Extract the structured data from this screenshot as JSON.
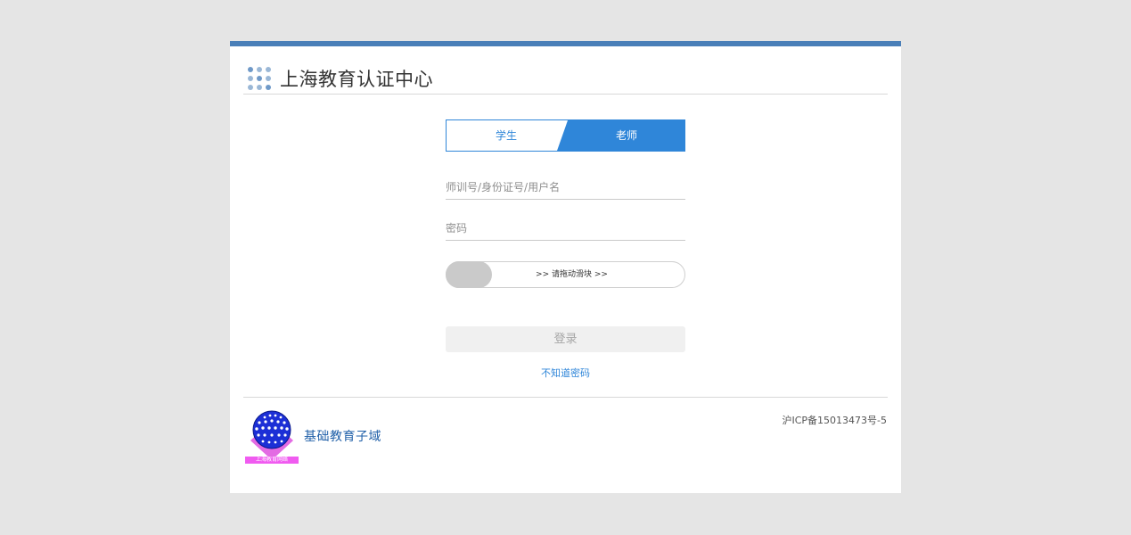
{
  "header": {
    "title": "上海教育认证中心"
  },
  "tabs": [
    {
      "label": "学生",
      "active": false
    },
    {
      "label": "老师",
      "active": true
    }
  ],
  "form": {
    "username_placeholder": "师训号/身份证号/用户名",
    "password_placeholder": "密码",
    "slider_text": ">> 请拖动滑块 >>",
    "login_label": "登录",
    "forgot_label": "不知道密码"
  },
  "footer": {
    "logo_text": "上海教育网络",
    "title": "基础教育子域",
    "icp": "沪ICP备15013473号-5"
  },
  "colors": {
    "accent": "#2f86d9",
    "topbar": "#4a7fb8",
    "logo_label": "#f05bf0"
  }
}
